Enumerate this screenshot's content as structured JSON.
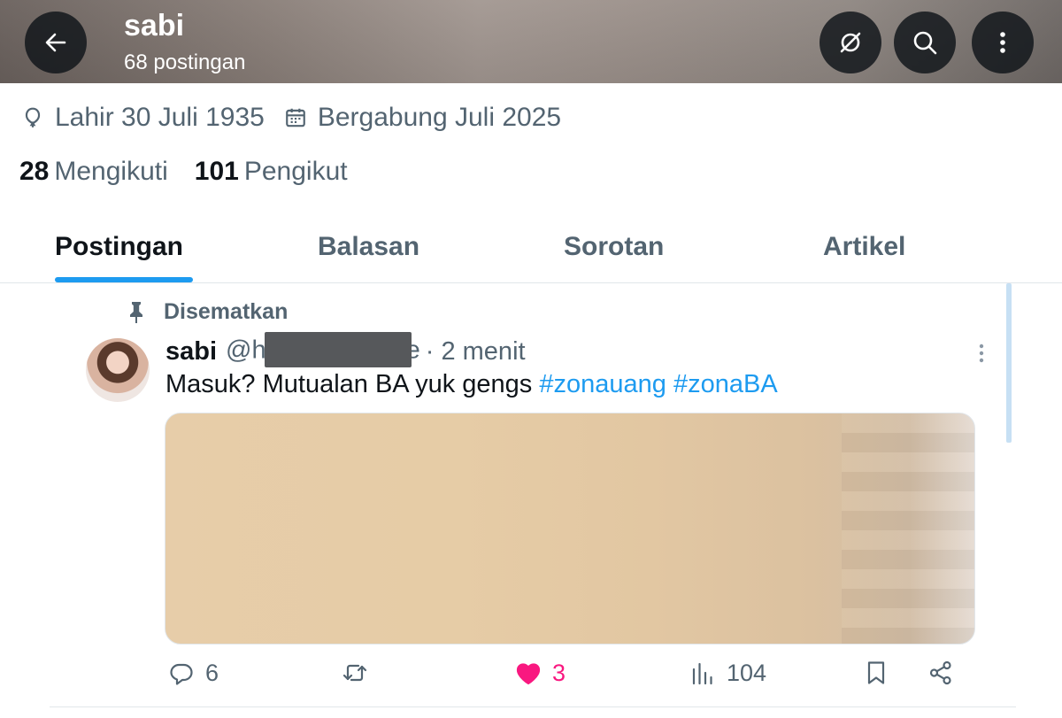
{
  "header": {
    "title": "sabi",
    "subtitle": "68 postingan"
  },
  "profile": {
    "birth": "Lahir 30 Juli 1935",
    "joined": "Bergabung Juli 2025",
    "following_count": "28",
    "following_label": "Mengikuti",
    "followers_count": "101",
    "followers_label": "Pengikut"
  },
  "tabs": [
    {
      "label": "Postingan",
      "active": true
    },
    {
      "label": "Balasan",
      "active": false
    },
    {
      "label": "Sorotan",
      "active": false
    },
    {
      "label": "Artikel",
      "active": false
    }
  ],
  "post": {
    "pinned_label": "Disematkan",
    "author_name": "sabi",
    "handle_start": "@h",
    "handle_end": "e",
    "time": "· 2 menit",
    "text": "Masuk? Mutualan BA yuk gengs",
    "hashtags": "#zonauang #zonaBA",
    "replies": "6",
    "likes": "3",
    "views": "104"
  },
  "icons": {
    "back": "arrow-left-icon",
    "grok": "grok-icon",
    "search": "search-icon",
    "more": "more-vertical-icon",
    "birth": "balloon-icon",
    "joined": "calendar-icon",
    "pinned": "pin-icon",
    "reply": "reply-icon",
    "repost": "repost-icon",
    "like": "heart-icon",
    "views": "views-icon",
    "bookmark": "bookmark-icon",
    "share": "share-icon"
  },
  "colors": {
    "accent": "#1d9bf0",
    "like": "#f91880",
    "secondary_text": "#536471"
  }
}
